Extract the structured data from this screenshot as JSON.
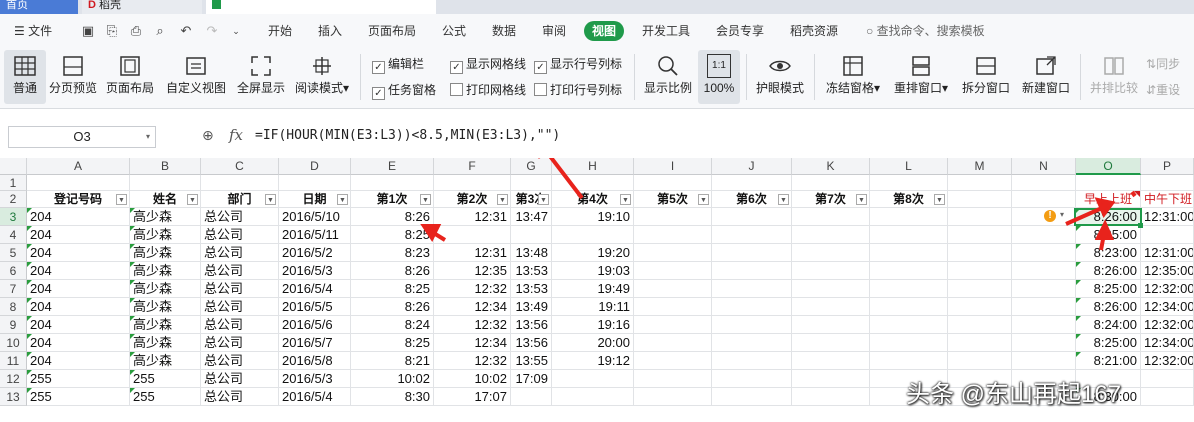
{
  "tab_strip": {
    "tabs": [
      "首页",
      "稻壳",
      ""
    ]
  },
  "menubar": {
    "file_label": "文件",
    "tabs": [
      "开始",
      "插入",
      "页面布局",
      "公式",
      "数据",
      "审阅",
      "视图",
      "开发工具",
      "会员专享",
      "稻壳资源"
    ],
    "active_tab": "视图",
    "search_placeholder": "查找命令、搜索模板"
  },
  "ribbon": {
    "buttons": {
      "normal": "普通",
      "page_break": "分页预览",
      "page_layout": "页面布局",
      "custom_view": "自定义视图",
      "fullscreen": "全屏显示",
      "reading_mode": "阅读模式",
      "zoom": "显示比例",
      "zoom_100": "100%",
      "eye_mode": "护眼模式",
      "freeze": "冻结窗格",
      "rearrange": "重排窗口",
      "split": "拆分窗口",
      "new_window": "新建窗口",
      "side_by_side": "并排比较",
      "sync_scroll": "同步",
      "reset": "重设"
    },
    "checkboxes": {
      "edit_bar": "编辑栏",
      "task_pane": "任务窗格",
      "show_gridlines": "显示网格线",
      "print_gridlines": "打印网格线",
      "show_headers": "显示行号列标",
      "print_headers": "打印行号列标"
    },
    "checked": {
      "edit_bar": true,
      "task_pane": true,
      "show_gridlines": true,
      "print_gridlines": false,
      "show_headers": true,
      "print_headers": false
    },
    "zoom_icon_text": "1:1"
  },
  "formula_bar": {
    "cell_ref": "O3",
    "fx": "fx",
    "formula": "=IF(HOUR(MIN(E3:L3))<8.5,MIN(E3:L3),\"\")"
  },
  "sheet": {
    "columns": [
      "A",
      "B",
      "C",
      "D",
      "E",
      "F",
      "G",
      "H",
      "I",
      "J",
      "K",
      "L",
      "M",
      "N",
      "O",
      "P"
    ],
    "selected_column": "O",
    "selected_row": "3",
    "row_numbers": [
      "1",
      "2",
      "3",
      "4",
      "5",
      "6",
      "7",
      "8",
      "9",
      "10",
      "11",
      "12",
      "13"
    ],
    "header_row": [
      "登记号码",
      "姓名",
      "部门",
      "日期",
      "第1次",
      "第2次",
      "第3次",
      "第4次",
      "第5次",
      "第6次",
      "第7次",
      "第8次",
      "",
      "",
      "早上上班",
      "中午下班"
    ],
    "rows": [
      [
        "204",
        "高少森",
        "总公司",
        "2016/5/10",
        "8:26",
        "12:31",
        "13:47",
        "19:10",
        "",
        "",
        "",
        "",
        "",
        "",
        "8:26:00",
        "12:31:00"
      ],
      [
        "204",
        "高少森",
        "总公司",
        "2016/5/11",
        "8:25",
        "",
        "",
        "",
        "",
        "",
        "",
        "",
        "",
        "",
        "8:25:00",
        ""
      ],
      [
        "204",
        "高少森",
        "总公司",
        "2016/5/2",
        "8:23",
        "12:31",
        "13:48",
        "19:20",
        "",
        "",
        "",
        "",
        "",
        "",
        "8:23:00",
        "12:31:00"
      ],
      [
        "204",
        "高少森",
        "总公司",
        "2016/5/3",
        "8:26",
        "12:35",
        "13:53",
        "19:03",
        "",
        "",
        "",
        "",
        "",
        "",
        "8:26:00",
        "12:35:00"
      ],
      [
        "204",
        "高少森",
        "总公司",
        "2016/5/4",
        "8:25",
        "12:32",
        "13:53",
        "19:49",
        "",
        "",
        "",
        "",
        "",
        "",
        "8:25:00",
        "12:32:00"
      ],
      [
        "204",
        "高少森",
        "总公司",
        "2016/5/5",
        "8:26",
        "12:34",
        "13:49",
        "19:11",
        "",
        "",
        "",
        "",
        "",
        "",
        "8:26:00",
        "12:34:00"
      ],
      [
        "204",
        "高少森",
        "总公司",
        "2016/5/6",
        "8:24",
        "12:32",
        "13:56",
        "19:16",
        "",
        "",
        "",
        "",
        "",
        "",
        "8:24:00",
        "12:32:00"
      ],
      [
        "204",
        "高少森",
        "总公司",
        "2016/5/7",
        "8:25",
        "12:34",
        "13:56",
        "20:00",
        "",
        "",
        "",
        "",
        "",
        "",
        "8:25:00",
        "12:34:00"
      ],
      [
        "204",
        "高少森",
        "总公司",
        "2016/5/8",
        "8:21",
        "12:32",
        "13:55",
        "19:12",
        "",
        "",
        "",
        "",
        "",
        "",
        "8:21:00",
        "12:32:00"
      ],
      [
        "255",
        "255",
        "总公司",
        "2016/5/3",
        "10:02",
        "10:02",
        "17:09",
        "",
        "",
        "",
        "",
        "",
        "",
        "",
        "",
        ""
      ],
      [
        "255",
        "255",
        "总公司",
        "2016/5/4",
        "8:30",
        "17:07",
        "",
        "",
        "",
        "",
        "",
        "",
        "",
        "",
        "8:30:00",
        ""
      ]
    ]
  },
  "watermark": "头条 @东山再起167",
  "colors": {
    "accent": "#1f9a4a",
    "header_red": "#d0191f",
    "arrow": "#e8231c",
    "warning": "#f39c12"
  }
}
